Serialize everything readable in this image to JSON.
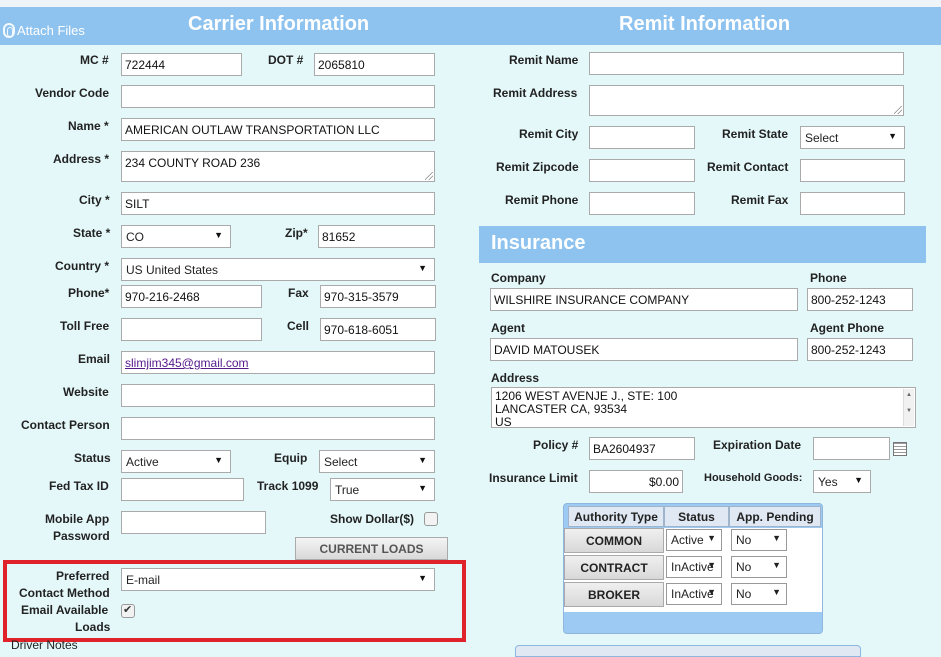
{
  "attach_label": "Attach Files",
  "carrier": {
    "title": "Carrier Information",
    "mc_label": "MC #",
    "mc": "722444",
    "dot_label": "DOT #",
    "dot": "2065810",
    "vendor_label": "Vendor Code",
    "vendor": "",
    "name_label": "Name *",
    "name": "AMERICAN OUTLAW TRANSPORTATION LLC",
    "address_label": "Address *",
    "address": "234 COUNTY ROAD 236",
    "city_label": "City *",
    "city": "SILT",
    "state_label": "State *",
    "state": "CO",
    "zip_label": "Zip*",
    "zip": "81652",
    "country_label": "Country *",
    "country": "US United States",
    "phone_label": "Phone*",
    "phone": "970-216-2468",
    "fax_label": "Fax",
    "fax": "970-315-3579",
    "tollfree_label": "Toll Free",
    "tollfree": "",
    "cell_label": "Cell",
    "cell": "970-618-6051",
    "email_label": "Email",
    "email": "slimjim345@gmail.com",
    "website_label": "Website",
    "website": "",
    "contact_label": "Contact Person",
    "contact": "",
    "status_label": "Status",
    "status": "Active",
    "equip_label": "Equip",
    "equip": "Select",
    "fedtax_label": "Fed Tax ID",
    "fedtax": "",
    "track_label": "Track 1099",
    "track": "True",
    "mobile_label_1": "Mobile App",
    "mobile_label_2": "Password",
    "mobile": "",
    "showdollar_label": "Show Dollar($)",
    "current_loads_label": "CURRENT LOADS",
    "pref_label_1": "Preferred",
    "pref_label_2": "Contact Method",
    "pref": "E-mail",
    "emailavail_label_1": "Email Available",
    "emailavail_label_2": "Loads",
    "driver_notes_label": "Driver Notes"
  },
  "remit": {
    "title": "Remit Information",
    "name_label": "Remit Name",
    "name": "",
    "address_label": "Remit Address",
    "address": "",
    "city_label": "Remit City",
    "city": "",
    "state_label": "Remit State",
    "state": "Select",
    "zip_label": "Remit Zipcode",
    "zip": "",
    "contact_label": "Remit Contact",
    "contact": "",
    "phone_label": "Remit Phone",
    "phone": "",
    "fax_label": "Remit Fax",
    "fax": ""
  },
  "insurance": {
    "title": "Insurance",
    "company_label": "Company",
    "company": "WILSHIRE INSURANCE COMPANY",
    "phone_label": "Phone",
    "phone": "800-252-1243",
    "agent_label": "Agent",
    "agent": "DAVID MATOUSEK",
    "agent_phone_label": "Agent Phone",
    "agent_phone": "800-252-1243",
    "address_label": "Address",
    "address_line1": "1206 WEST AVENJE J., STE: 100",
    "address_line2": "LANCASTER CA, 93534",
    "address_line3": "US",
    "policy_label": "Policy #",
    "policy": "BA2604937",
    "expiration_label": "Expiration Date",
    "expiration": "",
    "limit_label": "Insurance Limit",
    "limit": "$0.00",
    "household_label": "Household Goods:",
    "household": "Yes"
  },
  "authority": {
    "headers": [
      "Authority Type",
      "Status",
      "App. Pending"
    ],
    "rows": [
      {
        "type": "COMMON",
        "status": "Active",
        "pending": "No"
      },
      {
        "type": "CONTRACT",
        "status": "InActive",
        "pending": "No"
      },
      {
        "type": "BROKER",
        "status": "InActive",
        "pending": "No"
      }
    ]
  },
  "colors": {
    "header_blue": "#8ec3ef",
    "background": "#e4f8fa",
    "highlight_red": "#e0222a"
  }
}
